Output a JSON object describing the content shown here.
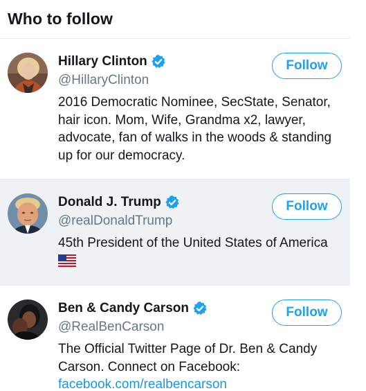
{
  "header": {
    "title": "Who to follow"
  },
  "accounts": [
    {
      "name": "Hillary Clinton",
      "handle": "@HillaryClinton",
      "bio": "2016 Democratic Nominee, SecState, Senator, hair icon. Mom, Wife, Grandma x2, lawyer, advocate, fan of walks in the woods & standing up for our democracy.",
      "follow_label": "Follow",
      "verified": true
    },
    {
      "name": "Donald J. Trump",
      "handle": "@realDonaldTrump",
      "bio": "45th President of the United States of America",
      "bio_emoji": "us-flag-icon",
      "follow_label": "Follow",
      "verified": true
    },
    {
      "name": "Ben & Candy Carson",
      "handle": "@RealBenCarson",
      "bio": "The Official Twitter Page of Dr. Ben & Candy Carson. Connect on Facebook:",
      "bio_link": "facebook.com/realbencarson",
      "follow_label": "Follow",
      "verified": true
    }
  ],
  "colors": {
    "accent": "#1da1f2",
    "link": "#1b95e0",
    "text": "#14171a",
    "muted": "#657786",
    "highlight_row": "#eef2f5",
    "divider": "#e6ecf0"
  }
}
